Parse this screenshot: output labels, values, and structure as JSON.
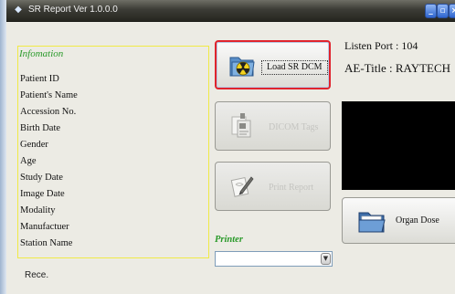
{
  "window": {
    "title": "SR Report  Ver 1.0.0.0"
  },
  "info": {
    "title": "Infomation",
    "labels": [
      "Patient ID",
      "Patient's Name",
      "Accession No.",
      "Birth Date",
      "Gender",
      "Age",
      "Study Date",
      "Image Date",
      "Modality",
      "Manufactuer",
      "Station Name"
    ]
  },
  "buttons": {
    "load_sr_dcm": "Load SR DCM",
    "dicom_tags": "DICOM Tags",
    "print_report": "Print Report",
    "organ_dose": "Organ Dose"
  },
  "printer": {
    "label": "Printer",
    "selected": ""
  },
  "connection": {
    "listen_port": "Listen Port : 104",
    "ae_title": "AE-Title : RAYTECH"
  },
  "status": {
    "text": "Rece."
  },
  "colors": {
    "highlight_border": "#e0242d",
    "panel_border": "#f0ea45",
    "label_green": "#2a9a2a",
    "viewer_bg": "#000000"
  },
  "icons": {
    "load": "radiation-folder-icon",
    "dicom": "document-icon",
    "print": "pen-document-icon",
    "organ": "folder-icon"
  }
}
